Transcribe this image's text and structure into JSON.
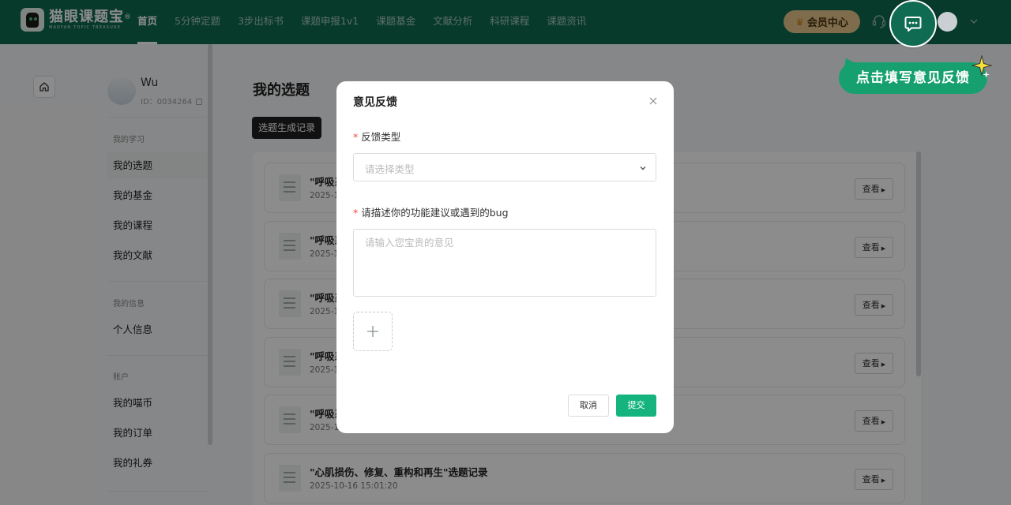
{
  "brand": {
    "name": "猫眼课题宝",
    "registered": "®",
    "tagline": "MAOYAN TOPIC TREASURE"
  },
  "nav": {
    "items": [
      {
        "label": "首页",
        "active": true
      },
      {
        "label": "5分钟定题",
        "active": false
      },
      {
        "label": "3步出标书",
        "active": false
      },
      {
        "label": "课题申报1v1",
        "active": false
      },
      {
        "label": "课题基金",
        "active": false
      },
      {
        "label": "文献分析",
        "active": false
      },
      {
        "label": "科研课程",
        "active": false
      },
      {
        "label": "课题资讯",
        "active": false
      }
    ],
    "vip_label": "会员中心"
  },
  "tooltip": {
    "text": "点击填写意见反馈"
  },
  "profile": {
    "name": "Wu",
    "id_text": "ID：0034264"
  },
  "sidebar": {
    "group_study": "我的学习",
    "study_items": [
      "我的选题",
      "我的基金",
      "我的课程",
      "我的文献"
    ],
    "group_info": "我的信息",
    "info_items": [
      "个人信息"
    ],
    "group_account": "账户",
    "account_items": [
      "我的喵币",
      "我的订单",
      "我的礼券"
    ]
  },
  "main": {
    "title": "我的选题",
    "tab_label": "选题生成记录",
    "view_label": "查看",
    "records": [
      {
        "title": "\"呼吸系",
        "time": "2025-1"
      },
      {
        "title": "\"呼吸系",
        "time": "2025-1"
      },
      {
        "title": "\"呼吸系",
        "time": "2025-1"
      },
      {
        "title": "\"呼吸系",
        "time": "2025-1"
      },
      {
        "title": "\"呼吸系",
        "time": "2025-1"
      },
      {
        "title": "\"心肌损伤、修复、重构和再生\"选题记录",
        "time": "2025-10-16 15:01:20"
      }
    ]
  },
  "modal": {
    "title": "意见反馈",
    "type_label": "反馈类型",
    "type_placeholder": "请选择类型",
    "desc_label": "请描述你的功能建议或遇到的bug",
    "desc_placeholder": "请输入您宝贵的意见",
    "cancel_label": "取消",
    "submit_label": "提交"
  },
  "colors": {
    "brand_green": "#0f6b51",
    "accent_green": "#15b47f",
    "vip_gold": "#e5c58a",
    "required_red": "#f0483e"
  }
}
